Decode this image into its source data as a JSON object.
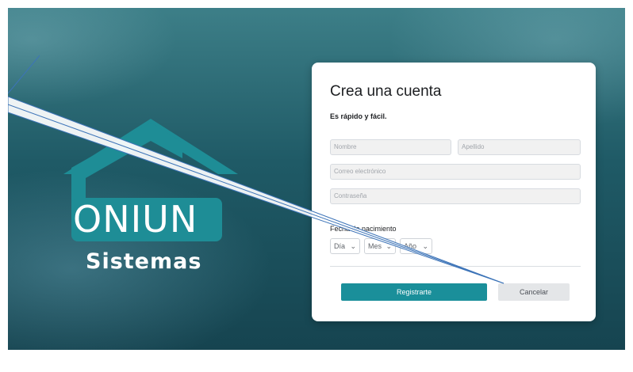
{
  "logo": {
    "word": "ONIUN",
    "sub": "Sistemas",
    "colors": {
      "house": "#1e8d96",
      "roof": "#1e8d96"
    },
    "icon": "house-icon"
  },
  "form": {
    "title": "Crea una cuenta",
    "subtitle": "Es rápido y fácil.",
    "first_name_placeholder": "Nombre",
    "last_name_placeholder": "Apellido",
    "email_placeholder": "Correo electrónico",
    "password_placeholder": "Contraseña",
    "dob_label": "Fecha de nacimiento",
    "day_label": "Día",
    "month_label": "Mes",
    "year_label": "Año",
    "register_label": "Registrarte",
    "cancel_label": "Cancelar",
    "colors": {
      "primary": "#1a8f9a",
      "secondary": "#e4e6e8"
    }
  }
}
